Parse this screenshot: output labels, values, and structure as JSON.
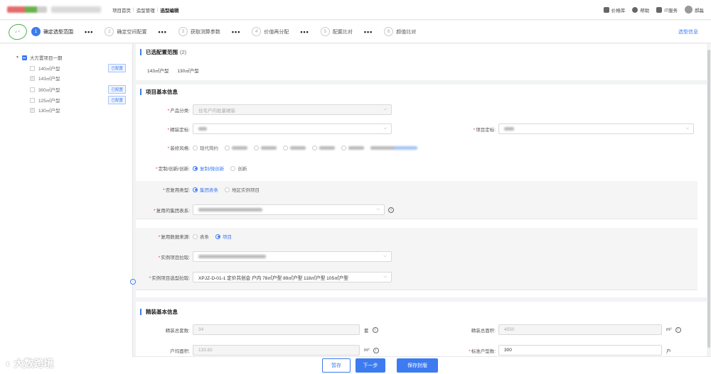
{
  "topbar": {
    "nav": [
      "项目首页",
      "造型管理",
      "选型编辑"
    ],
    "right": [
      "价格库",
      "帮助",
      "IT服务",
      "郝磊"
    ]
  },
  "steps": [
    {
      "num": "1",
      "label": "确定选型范围",
      "active": true
    },
    {
      "num": "2",
      "label": "确定空间配置",
      "active": false
    },
    {
      "num": "3",
      "label": "获取测算参数",
      "active": false
    },
    {
      "num": "4",
      "label": "价值再分配",
      "active": false
    },
    {
      "num": "5",
      "label": "配置比对",
      "active": false
    },
    {
      "num": "6",
      "label": "颜值比对",
      "active": false
    }
  ],
  "steps_dots": "•••",
  "select_info": "选型信息",
  "tree": {
    "root": "大方置项目一期",
    "items": [
      {
        "label": "140㎡户型",
        "tag": "已配置",
        "checked": false
      },
      {
        "label": "143㎡户型",
        "tag": "",
        "checked": true
      },
      {
        "label": "300㎡户型",
        "tag": "已配置",
        "checked": false
      },
      {
        "label": "125㎡户型",
        "tag": "已配置",
        "checked": false
      },
      {
        "label": "130㎡户型",
        "tag": "",
        "checked": true
      }
    ]
  },
  "chosen_scope": {
    "title": "已选配置范围",
    "count": "(2)",
    "items": [
      "143㎡户型",
      "130㎡户型"
    ]
  },
  "basic_info": {
    "title": "项目基本信息",
    "product_class_label": "产品分类:",
    "product_class_value": "住宅户内批量硬装",
    "decoration_label": "精装定标:",
    "project_position_label": "项目定标:",
    "style_label": "装修风格:",
    "style_first": "现代简约",
    "innovation_label": "定制/创新/创新:",
    "innovation_options": [
      "复制/微创新",
      "创新"
    ],
    "reuse_type_label": "否复用类型:",
    "reuse_type_options": [
      "集团表条",
      "地区实例项目"
    ],
    "reuse_table_label": "复用的集团表系:",
    "data_source_label": "复用数据来源:",
    "data_source_options": [
      "表条",
      "项目"
    ],
    "instance_project_label": "实例项目拉取:",
    "instance_type_label": "实例项目选型拉取:",
    "instance_type_value": "XPJZ-D-01-1 定价共创会 户内 78㎡户型 89㎡户型 118㎡户型 105㎡户型"
  },
  "fit_info": {
    "title": "精装基本信息",
    "sets_label": "精装总套数:",
    "sets_value": "34",
    "sets_unit": "套",
    "area_label": "精装总面积:",
    "area_value": "4550",
    "area_unit": "m²",
    "inner_area_label": "户均面积:",
    "inner_area_value": "133.82",
    "inner_area_unit": "m²",
    "std_sets_label": "标准户型数:",
    "std_sets_value": "300",
    "std_sets_unit": "户"
  },
  "footer": {
    "save_draft": "暂存",
    "next": "下一步",
    "save_seal": "保存封版"
  },
  "watermark": "大数跨境",
  "colors": {
    "accent": "#3d7bf0",
    "required": "#e53935",
    "tag_bg": "#eef4ff"
  }
}
